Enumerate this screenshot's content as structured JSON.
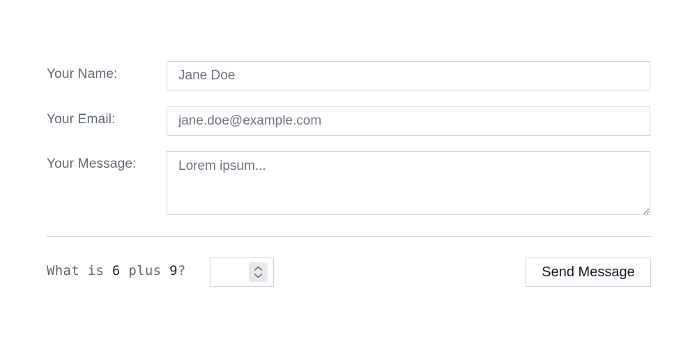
{
  "form": {
    "name": {
      "label": "Your Name:",
      "placeholder": "Jane Doe",
      "value": ""
    },
    "email": {
      "label": "Your Email:",
      "placeholder": "jane.doe@example.com",
      "value": ""
    },
    "message": {
      "label": "Your Message:",
      "placeholder": "Lorem ipsum...",
      "value": ""
    },
    "captcha": {
      "prefix": "What is ",
      "a": "6",
      "middle": " plus ",
      "b": "9",
      "suffix": "?",
      "answer_value": ""
    },
    "submit_label": "Send Message"
  },
  "icons": {
    "spinner": "up-down-chevron-icon"
  },
  "colors": {
    "label": "#5f6773",
    "border": "#cfd3d8",
    "divider": "#d4d7db",
    "button_text": "#111827"
  }
}
